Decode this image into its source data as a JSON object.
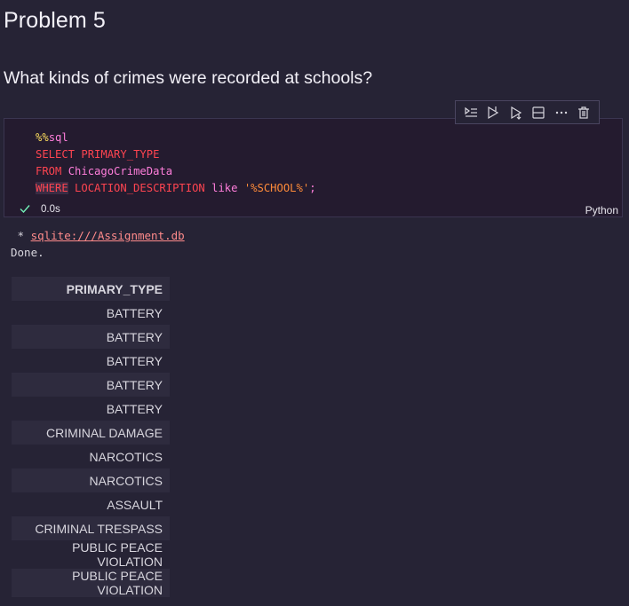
{
  "markdown": {
    "heading": "Problem 5",
    "question": "What kinds of crimes were recorded at schools?"
  },
  "cell": {
    "toolbar": [
      {
        "name": "run-by-line-icon"
      },
      {
        "name": "execute-above-icon"
      },
      {
        "name": "execute-below-icon"
      },
      {
        "name": "split-cell-icon"
      },
      {
        "name": "more-actions-icon"
      },
      {
        "name": "delete-cell-icon"
      }
    ],
    "code": {
      "line1_magic": "%%",
      "line1_rest": "sql",
      "line2_kw": "SELECT",
      "line2_rest": " PRIMARY_TYPE",
      "line3_kw": "FROM",
      "line3_rest": " ChicagoCrimeData",
      "line4_kw": "WHERE",
      "line4_mid": " LOCATION_DESCRIPTION ",
      "line4_like": "like",
      "line4_str": " '%SCHOOL%'",
      "line4_end": ";"
    },
    "status": {
      "icon": "check-icon",
      "time": "0.0s",
      "language": "Python"
    }
  },
  "output": {
    "prefix": " * ",
    "db_link": "sqlite:///Assignment.db",
    "done": "Done.",
    "table": {
      "header": "PRIMARY_TYPE",
      "rows": [
        "BATTERY",
        "BATTERY",
        "BATTERY",
        "BATTERY",
        "BATTERY",
        "CRIMINAL DAMAGE",
        "NARCOTICS",
        "NARCOTICS",
        "ASSAULT",
        "CRIMINAL TRESPASS",
        "PUBLIC PEACE VIOLATION",
        "PUBLIC PEACE VIOLATION"
      ]
    }
  },
  "colors": {
    "background": "#262335",
    "cell_background": "#241b2f",
    "keyword": "#fe4450",
    "magic": "#fede5d",
    "identifier": "#ff7edb",
    "string": "#ff8b39",
    "success": "#72f1b8"
  }
}
